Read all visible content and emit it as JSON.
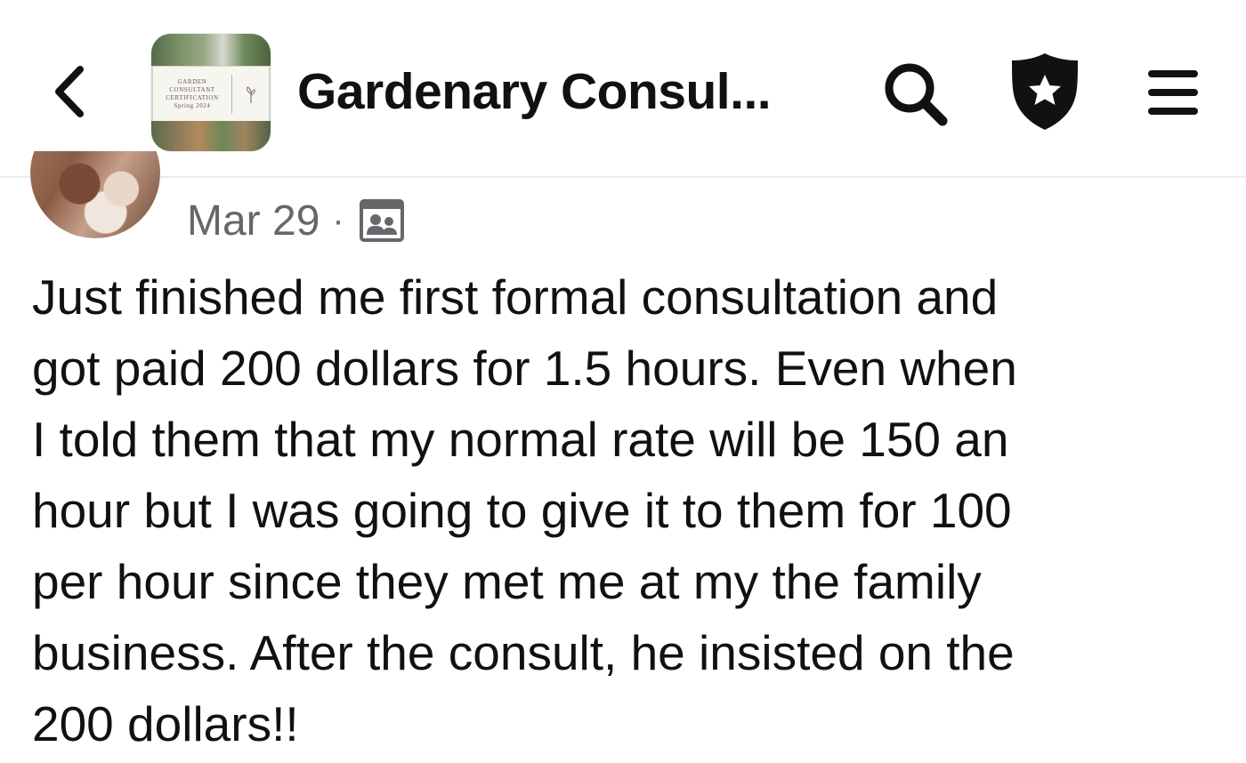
{
  "header": {
    "title": "Gardenary Consul...",
    "group_thumb_card_text": "GARDEN\nCONSULTANT\nCERTIFICATION\nSpring 2024",
    "icons": {
      "back": "chevron-left-icon",
      "search": "search-icon",
      "shield": "shield-star-icon",
      "menu": "menu-icon"
    }
  },
  "post": {
    "date": "Mar 29",
    "separator": "·",
    "privacy_icon": "members-group-icon",
    "body_lines": [
      "Just finished me first formal consultation and",
      "got paid 200 dollars for 1.5 hours. Even when",
      "I told them that my normal rate will be 150 an",
      "hour but I was going to give it to them for 100",
      "per hour since they met me at my the family",
      "business. After the consult, he insisted on the",
      "200 dollars!!"
    ]
  },
  "colors": {
    "text_primary": "#111111",
    "text_secondary": "#65676b",
    "divider": "#ececec",
    "background": "#ffffff"
  }
}
